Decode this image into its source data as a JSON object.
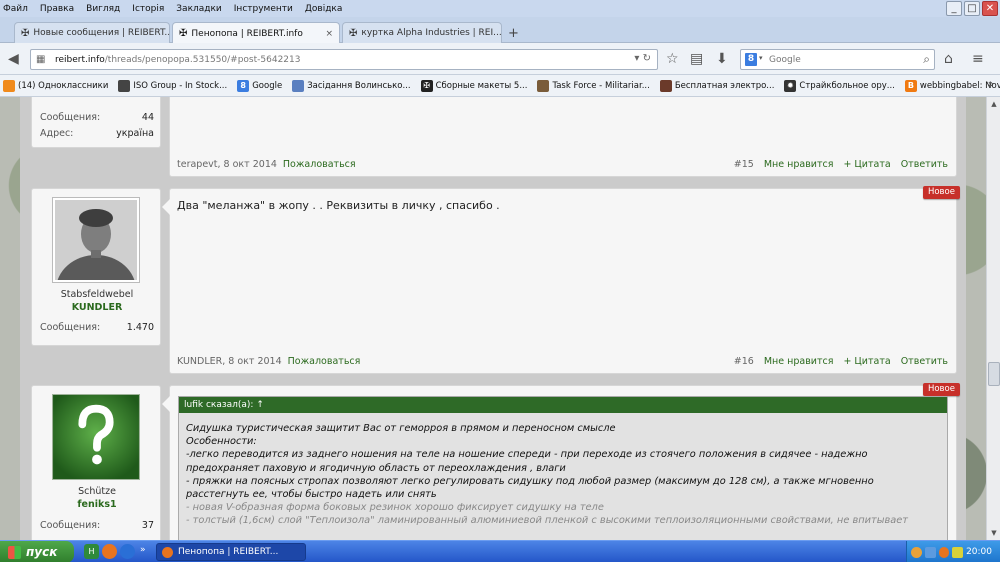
{
  "menu": [
    "Файл",
    "Правка",
    "Вигляд",
    "Історія",
    "Закладки",
    "Інструменти",
    "Довідка"
  ],
  "window_buttons": {
    "minimize": "_",
    "maximize": "□",
    "close": "✕"
  },
  "tabs": [
    {
      "label": "Новые сообщения | REIBERT...",
      "active": false,
      "close": "×"
    },
    {
      "label": "Пенопопа | REIBERT.info",
      "active": true,
      "close": "×"
    },
    {
      "label": "куртка Alpha Industries | REI...",
      "active": false,
      "close": "×"
    }
  ],
  "newtab_label": "+",
  "nav": {
    "url_host": "reibert.info",
    "url_path": "/threads/penopopa.531550/#post-5642213",
    "search_placeholder": "Google",
    "search_badge": "8"
  },
  "bookmarks": [
    {
      "label": "(14) Одноклассники",
      "color": "#f08a1c",
      "glyph": "ok"
    },
    {
      "label": "ISO Group - In Stock...",
      "color": "#444",
      "glyph": "iso"
    },
    {
      "label": "Google",
      "color": "#3b7de0",
      "glyph": "8"
    },
    {
      "label": "Засідання Волинсько...",
      "color": "#5a7fc0",
      "glyph": "◆"
    },
    {
      "label": "Сборные макеты 5...",
      "color": "#222",
      "glyph": "✠"
    },
    {
      "label": "Task Force - Militariar...",
      "color": "#7a5c3a",
      "glyph": "▪"
    },
    {
      "label": "Бесплатная электро...",
      "color": "#6b3a2a",
      "glyph": "▪"
    },
    {
      "label": "Страйкбольное ору...",
      "color": "#333",
      "glyph": "✹"
    },
    {
      "label": "webbingbabel: Novem...",
      "color": "#f07a12",
      "glyph": "B"
    }
  ],
  "posts": [
    {
      "user_label_stats": [
        {
          "k": "Сообщения:",
          "v": "44"
        },
        {
          "k": "Адрес:",
          "v": "україна"
        }
      ],
      "author_date": "terapevt, 8 окт 2014",
      "report": "Пожаловаться",
      "num": "#15",
      "actions": [
        "Мне нравится",
        "+ Цитата",
        "Ответить"
      ]
    },
    {
      "user_title": "Stabsfeldwebel",
      "user_name": "KUNDLER",
      "stats": [
        {
          "k": "Сообщения:",
          "v": "1.470"
        }
      ],
      "text": "Два \"меланжа\" в жопу . . Реквизиты в личку , спасибо .",
      "badge": "Новое",
      "author_date": "KUNDLER, 8 окт 2014",
      "report": "Пожаловаться",
      "num": "#16",
      "actions": [
        "Мне нравится",
        "+ Цитата",
        "Ответить"
      ]
    },
    {
      "user_title": "Schütze",
      "user_name": "feniks1",
      "stats": [
        {
          "k": "Сообщения:",
          "v": "37"
        }
      ],
      "badge": "Новое",
      "quote_head": "lufik сказал(а): ↑",
      "quote_lines": [
        "Сидушка туристическая защитит Вас от геморроя в прямом и переносном смысле",
        "Особенности:",
        "-легко переводится из заднего ношения на теле на ношение спереди - при переходе из стоячего положения в сидячее - надежно",
        "предохраняет паховую и ягодичную область от переохлаждения , влаги",
        "- пряжки на поясных стропах позволяют легко регулировать сидушку под любой размер (максимум до 128 см), а также мгновенно",
        "расстегнуть ее, чтобы быстро надеть или снять",
        "- новая V-образная форма боковых резинок хорошо фиксирует сидушку на теле",
        "- толстый (1,6см) слой \"Теплоизола\" ламинированный алюминиевой пленкой с высокими теплоизоляционными свойствами, не впитывает"
      ]
    }
  ],
  "taskbar": {
    "start": "пуск",
    "task": "Пенопопа | REIBERT...",
    "clock": "20:00"
  },
  "colors": {
    "forum_green": "#2b6a1e",
    "badge_red": "#c7302a",
    "quote_header": "#2e6a27"
  }
}
